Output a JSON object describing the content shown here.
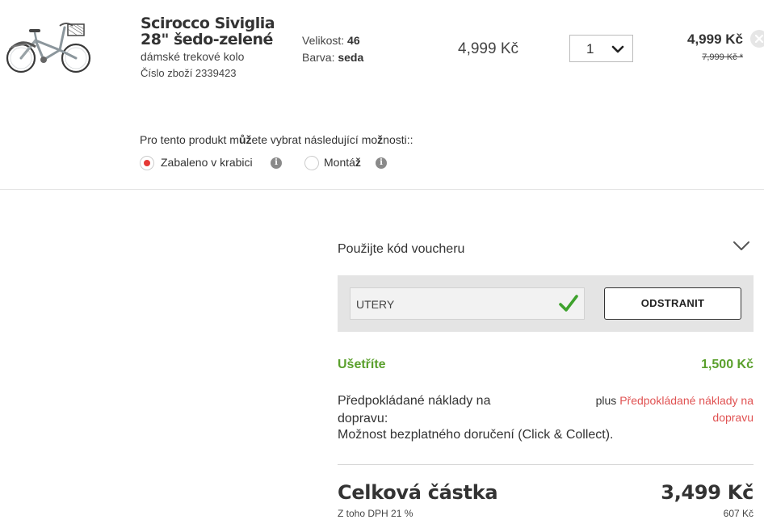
{
  "product": {
    "title": "Scirocco Siviglia 28\" šedo-zelené",
    "subtitle": "dámské trekové kolo",
    "item_number": "Číslo zboží 2339423",
    "size_label": "Velikost:",
    "size_value": "46",
    "color_label": "Barva:",
    "color_value": "seda",
    "unit_price": "4,999 Kč",
    "quantity": "1",
    "line_total": "4,999 Kč",
    "original_price": "7,999 Kč *"
  },
  "options": {
    "title_part1": "Pro tento produkt m",
    "title_bold": "ůž",
    "title_part2": "ete vybrat následující mo",
    "title_bold2": "ž",
    "title_part3": "nosti::",
    "boxed_label": "Zabaleno v krabici",
    "assembly_label": "Montá",
    "assembly_bold": "ž",
    "selected": "boxed"
  },
  "voucher": {
    "title": "Použijte kód voucheru",
    "code": "UTERY",
    "remove_label": "ODSTRANIT"
  },
  "summary": {
    "save_label": "Ušetříte",
    "save_value": "1,500 Kč",
    "shipping_label": "Předpokládané náklady na dopravu:",
    "shipping_prefix": "plus ",
    "shipping_link": "Předpokládané náklady na dopravu",
    "free_delivery": "Možnost bezplatného doručení (Click & Collect).",
    "total_label": "Celková částka",
    "total_value": "3,499 Kč",
    "vat_label": "Z toho DPH 21 %",
    "vat_value": "607 Kč"
  },
  "colors": {
    "accent_green": "#5aa02c",
    "accent_red": "#e53935",
    "link_red": "#e05252"
  },
  "icons": {
    "remove": "close-icon",
    "info": "info-icon",
    "chevron": "chevron-down-icon",
    "check": "check-icon"
  }
}
